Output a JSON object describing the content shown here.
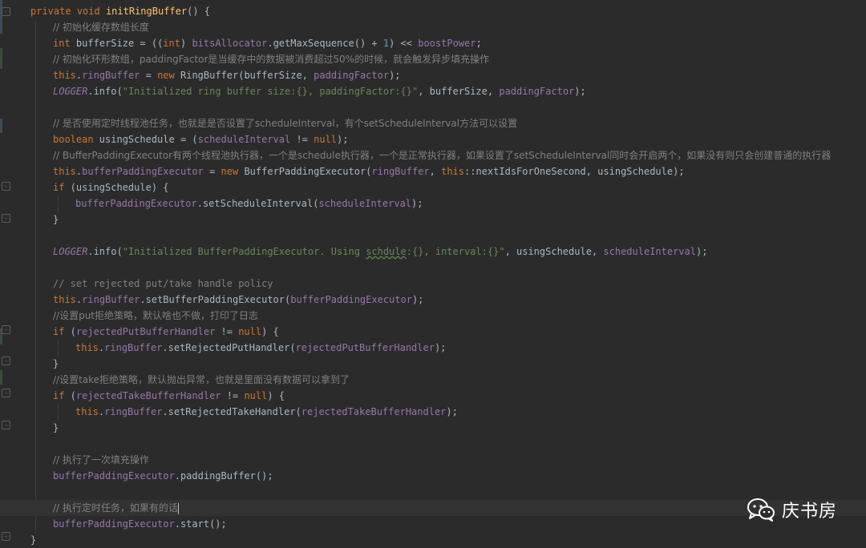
{
  "code": {
    "method_signature": [
      "private",
      "void",
      "initRingBuffer",
      "() {"
    ],
    "c1": "// 初始化缓存数组长度",
    "l2": {
      "t": "int",
      "v": "bufferSize",
      "a": " = ((",
      "cast": "int",
      "b": ") ",
      "f": "bitsAllocator",
      "c": ".getMaxSequence() + ",
      "n": "1",
      "d": ") << ",
      "p": "boostPower",
      "e": ";"
    },
    "c3": "// 初始化环形数组，paddingFactor是当缓存中的数据被消费超过50%的时候，就会触发异步填充操作",
    "l4": {
      "this": "this",
      "a": ".",
      "f": "ringBuffer",
      "b": " = ",
      "new": "new",
      "c": " RingBuffer(bufferSize, ",
      "p": "paddingFactor",
      "d": ");"
    },
    "l5": {
      "logger": "LOGGER",
      "a": ".info(",
      "s": "\"Initialized ring buffer size:{}, paddingFactor:{}\"",
      "b": ", bufferSize, ",
      "p": "paddingFactor",
      "c": ");"
    },
    "c7": "// 是否使用定时线程池任务，也就是是否设置了scheduleInterval，有个setScheduleInterval方法可以设置",
    "l8": {
      "t": "boolean",
      "v": " usingSchedule = (",
      "p": "scheduleInterval",
      "a": " != ",
      "null": "null",
      "b": ");"
    },
    "c9": "// BufferPaddingExecutor有两个线程池执行器，一个是schedule执行器，一个是正常执行器，如果设置了setScheduleInterval同时会开启两个，如果没有则只会创建普通的执行器",
    "l10": {
      "this": "this",
      "a": ".",
      "f": "bufferPaddingExecutor",
      "b": " = ",
      "new": "new",
      "c": " BufferPaddingExecutor(",
      "p": "ringBuffer",
      "d": ", ",
      "this2": "this",
      "e": "::nextIdsForOneSecond, usingSchedule);"
    },
    "l11": {
      "if": "if",
      "a": " (usingSchedule) {"
    },
    "l12": {
      "f": "bufferPaddingExecutor",
      "a": ".setScheduleInterval(",
      "p": "scheduleInterval",
      "b": ");"
    },
    "l13": "}",
    "l15": {
      "logger": "LOGGER",
      "a": ".info(",
      "s1": "\"Initialized BufferPaddingExecutor. Using ",
      "su": "schdule",
      "s2": ":{}, interval:{}\"",
      "b": ", usingSchedule, ",
      "p": "scheduleInterval",
      "c": ");"
    },
    "c17": "// set rejected put/take handle policy",
    "l18": {
      "this": "this",
      "a": ".",
      "f": "ringBuffer",
      "b": ".setBufferPaddingExecutor(",
      "p": "bufferPaddingExecutor",
      "c": ");"
    },
    "c19": "//设置put拒绝策略，默认啥也不做，打印了日志",
    "l20": {
      "if": "if",
      "a": " (",
      "p": "rejectedPutBufferHandler",
      "b": " != ",
      "null": "null",
      "c": ") {"
    },
    "l21": {
      "this": "this",
      "a": ".",
      "f": "ringBuffer",
      "b": ".setRejectedPutHandler(",
      "p": "rejectedPutBufferHandler",
      "c": ");"
    },
    "l22": "}",
    "c23": "//设置take拒绝策略，默认抛出异常，也就是里面没有数据可以拿到了",
    "l24": {
      "if": "if",
      "a": " (",
      "p": "rejectedTakeBufferHandler",
      "b": " != ",
      "null": "null",
      "c": ") {"
    },
    "l25": {
      "this": "this",
      "a": ".",
      "f": "ringBuffer",
      "b": ".setRejectedTakeHandler(",
      "p": "rejectedTakeBufferHandler",
      "c": ");"
    },
    "l26": "}",
    "c28": "// 执行了一次填充操作",
    "l29": {
      "f": "bufferPaddingExecutor",
      "a": ".paddingBuffer();"
    },
    "c31": "// 执行定时任务，如果有的话",
    "l32": {
      "f": "bufferPaddingExecutor",
      "a": ".start();"
    },
    "l33": "}"
  },
  "watermark": {
    "text": "庆书房",
    "icon": "wechat-icon"
  },
  "colors": {
    "background": "#2b2b2b",
    "keyword": "#cc7832",
    "method": "#ffc66d",
    "comment": "#808080",
    "string": "#6a8759",
    "number": "#6897bb",
    "field": "#9876aa",
    "text": "#a9b7c6"
  }
}
